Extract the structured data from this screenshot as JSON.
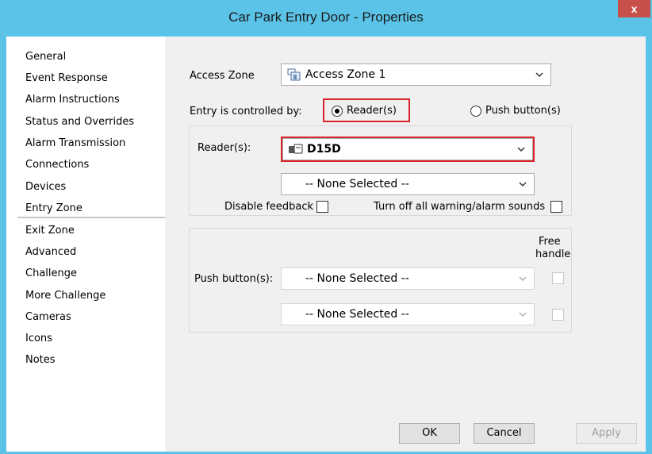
{
  "window": {
    "title": "Car Park Entry Door - Properties",
    "close_glyph": "x"
  },
  "sidebar": {
    "items": [
      {
        "label": "General"
      },
      {
        "label": "Event Response"
      },
      {
        "label": "Alarm Instructions"
      },
      {
        "label": "Status and Overrides"
      },
      {
        "label": "Alarm Transmission"
      },
      {
        "label": "Connections"
      },
      {
        "label": "Devices"
      },
      {
        "label": "Entry Zone"
      },
      {
        "label": "Exit Zone"
      },
      {
        "label": "Advanced"
      },
      {
        "label": "Challenge"
      },
      {
        "label": "More Challenge"
      },
      {
        "label": "Cameras"
      },
      {
        "label": "Icons"
      },
      {
        "label": "Notes"
      }
    ],
    "selected": "Entry Zone"
  },
  "entry_zone": {
    "access_zone_label": "Access Zone",
    "access_zone_value": "Access Zone 1",
    "controlled_by_label": "Entry is controlled by:",
    "radio_reader_label": "Reader(s)",
    "radio_push_label": "Push button(s)",
    "selected_control": "Reader(s)",
    "readers_label": "Reader(s):",
    "reader_1_value": "D15D",
    "reader_2_value": "-- None Selected --",
    "disable_feedback_label": "Disable feedback",
    "turn_off_sounds_label": "Turn off all warning/alarm sounds",
    "free_handle_label_1": "Free",
    "free_handle_label_2": "handle",
    "push_buttons_label": "Push button(s):",
    "push_1_value": "-- None Selected --",
    "push_2_value": "-- None Selected --"
  },
  "buttons": {
    "ok": "OK",
    "cancel": "Cancel",
    "apply": "Apply"
  },
  "colors": {
    "title_bar": "#5bc3e8",
    "close_button": "#c7504b",
    "highlight": "#d9252a"
  }
}
